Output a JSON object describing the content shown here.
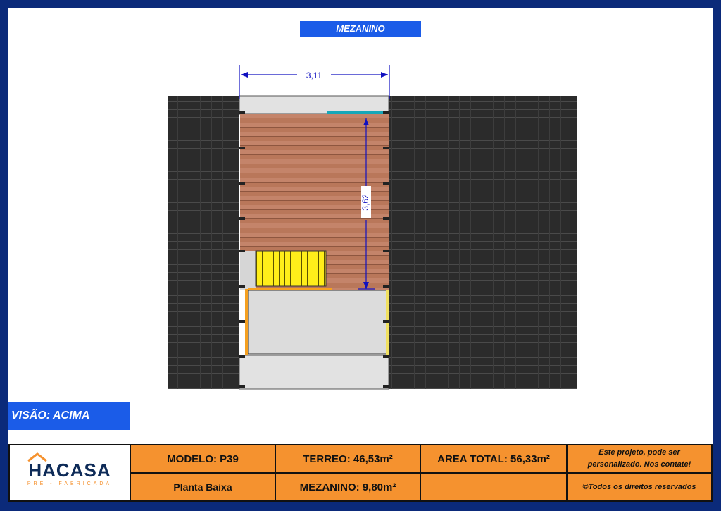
{
  "title": "MEZANINO",
  "view_label": "VISÃO: ACIMA",
  "dimensions": {
    "width": "3,11",
    "depth": "3,62"
  },
  "logo": {
    "name": "HACASA",
    "tagline": "PRÉ - FABRICADA"
  },
  "info": {
    "modelo": "MODELO: P39",
    "planta": "Planta Baixa",
    "terreo": "TERREO: 46,53m²",
    "mezanino": "MEZANINO: 9,80m²",
    "area_total": "AREA TOTAL: 56,33m²",
    "note_line1": "Este projeto, pode ser",
    "note_line2": "personalizado. Nos contate!",
    "copyright": "©Todos os direitos reservados"
  },
  "colors": {
    "frame": "#0b2a7a",
    "accent_blue": "#1b5ce8",
    "orange": "#f5922f"
  }
}
